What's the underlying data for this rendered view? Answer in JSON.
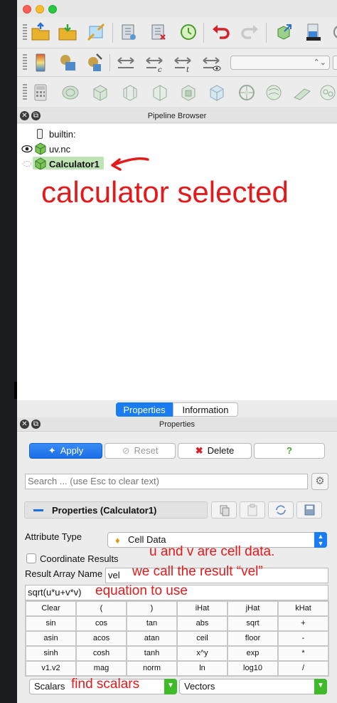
{
  "toolbar": {
    "row1_icons": [
      "open-file-icon",
      "open-folder-icon",
      "connect-icon",
      "load-state-icon",
      "save-state-icon",
      "undo-history-icon",
      "undo-icon",
      "redo-icon",
      "extract-icon",
      "color-map-icon",
      "camera-icon"
    ],
    "row2_icons": [
      "color-legend-icon",
      "rescale-range-icon",
      "custom-range-icon",
      "rescale-x-icon",
      "rescale-c-icon",
      "rescale-t-icon",
      "rescale-visible-icon"
    ],
    "row3_icons": [
      "calculator-icon",
      "contour-icon",
      "clip-icon",
      "slice-icon",
      "threshold-icon",
      "extract-subset-icon",
      "glyph-icon",
      "stream-tracer-icon",
      "warp-icon",
      "group-icon"
    ]
  },
  "pipeline": {
    "title": "Pipeline Browser",
    "items": [
      {
        "label": "builtin:"
      },
      {
        "label": "uv.nc"
      },
      {
        "label": "Calculator1"
      }
    ]
  },
  "tabs": [
    {
      "label": "Properties"
    },
    {
      "label": "Information"
    }
  ],
  "properties": {
    "title": "Properties",
    "apply_label": "Apply",
    "reset_label": "Reset",
    "delete_label": "Delete",
    "help_label": "?",
    "search_placeholder": "Search ... (use Esc to clear text)",
    "section_label": "Properties (Calculator1)",
    "attribute_type_label": "Attribute Type",
    "attribute_type_value": "Cell Data",
    "coordinate_results_label": "Coordinate Results",
    "result_array_name_label": "Result Array Name",
    "result_array_name_value": "vel",
    "expression_value": "sqrt(u*u+v*v)",
    "calc_keys": [
      "Clear",
      "(",
      ")",
      "iHat",
      "jHat",
      "kHat",
      "sin",
      "cos",
      "tan",
      "abs",
      "sqrt",
      "+",
      "asin",
      "acos",
      "atan",
      "ceil",
      "floor",
      "-",
      "sinh",
      "cosh",
      "tanh",
      "x^y",
      "exp",
      "*",
      "v1.v2",
      "mag",
      "norm",
      "ln",
      "log10",
      "/"
    ],
    "scalars_label": "Scalars",
    "vectors_label": "Vectors"
  },
  "annotations": {
    "calculator_selected": "calculator selected",
    "cell_data_note": "u and v are cell data.",
    "result_note": "we call the result “vel”",
    "equation_note": "equation to use",
    "scalars_note": "find scalars"
  },
  "colors": {
    "accent_blue": "#1a7cf1",
    "annotation_red": "#e3191b",
    "selection_green": "#bfe3b4"
  }
}
